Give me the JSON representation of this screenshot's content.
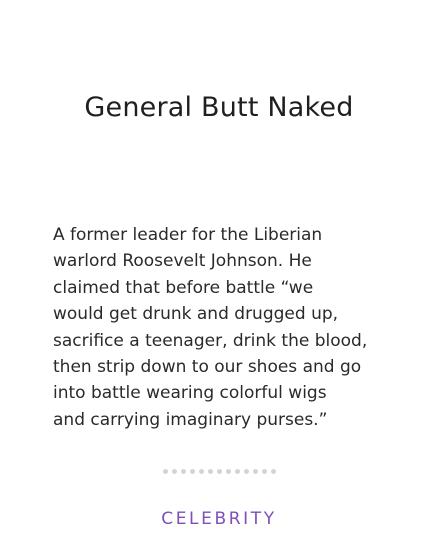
{
  "card": {
    "title": "General Butt Naked",
    "body_lines": [
      "A former leader for the Liberian",
      "warlord Roosevelt Johnson. He",
      "claimed that before battle “we",
      "would get drunk and drugged up,",
      "sacrifice a teenager, drink the blood,",
      "then strip down to our shoes and go",
      "into battle wearing colorful wigs",
      "and carrying imaginary purses.”"
    ],
    "category": "CELEBRITY",
    "accent_color": "#7e4fb8",
    "dot_color": "#d4d4d4",
    "dot_count": 13
  }
}
